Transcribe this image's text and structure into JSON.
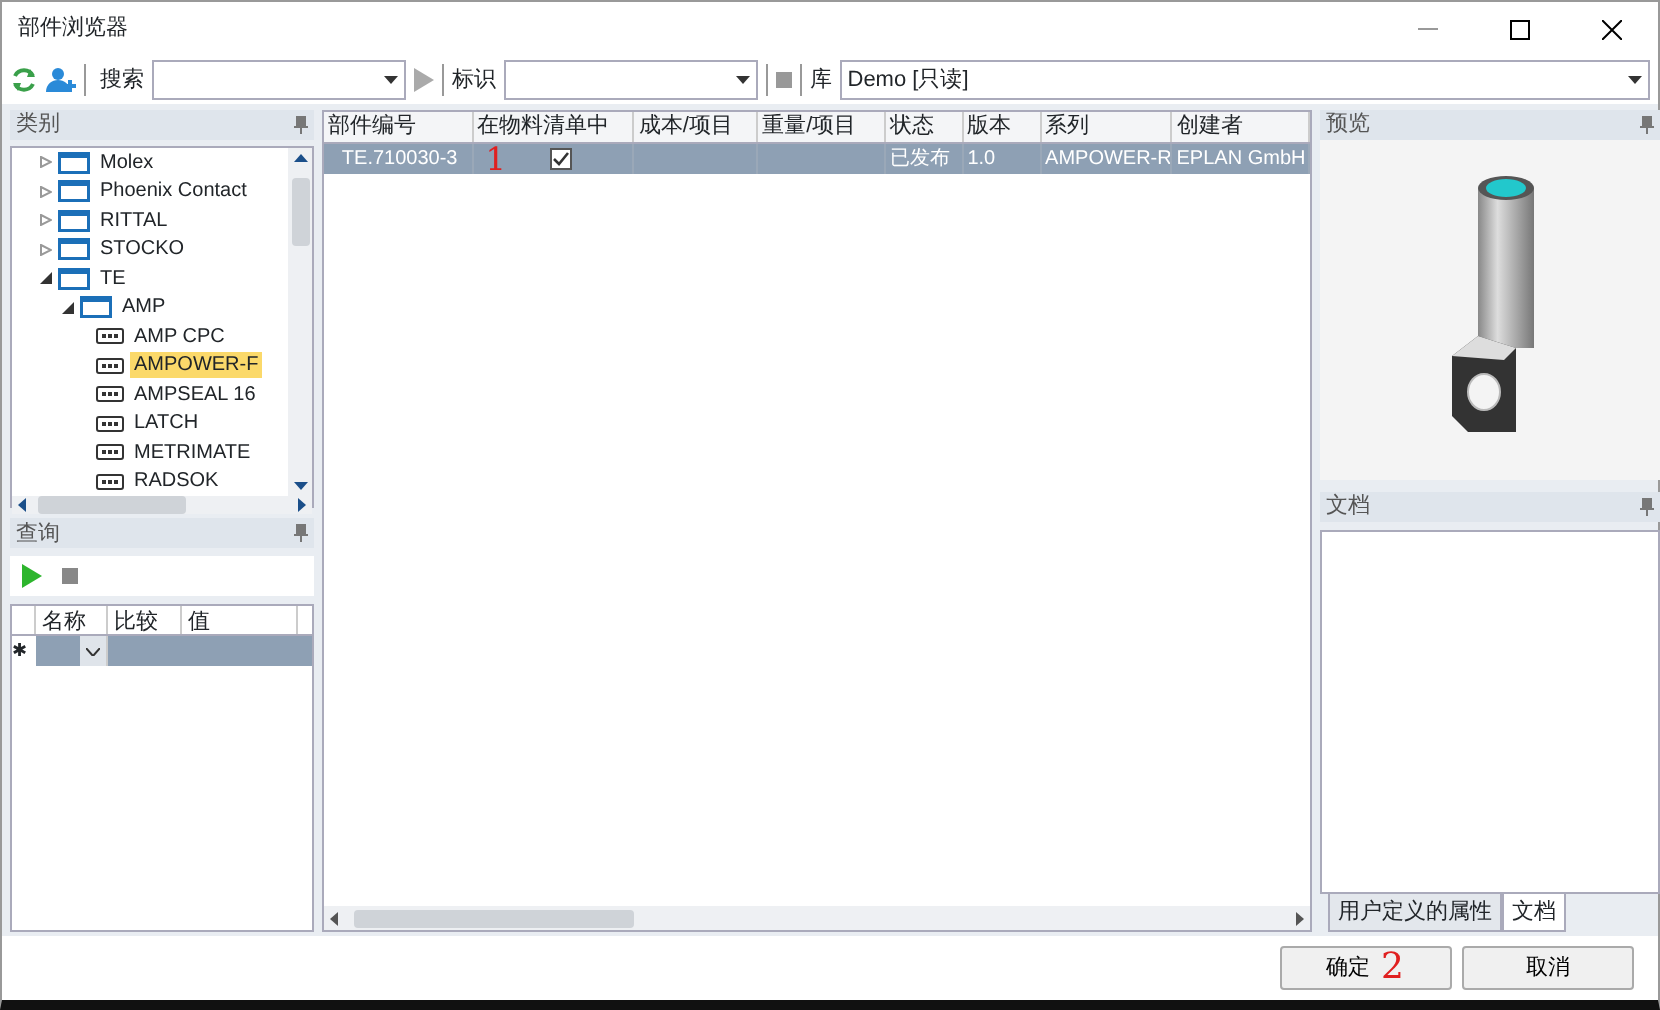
{
  "window": {
    "title": "部件浏览器"
  },
  "toolbar": {
    "search_label": "搜索",
    "play_disabled": true,
    "id_label": "标识",
    "library_label": "库",
    "library_value": "Demo [只读]"
  },
  "category_pane": {
    "title": "类别",
    "tree": [
      {
        "label": "Molex",
        "kind": "folder",
        "expanded": false,
        "selected": false
      },
      {
        "label": "Phoenix Contact",
        "kind": "folder",
        "expanded": false,
        "selected": false
      },
      {
        "label": "RITTAL",
        "kind": "folder",
        "expanded": false,
        "selected": false
      },
      {
        "label": "STOCKO",
        "kind": "folder",
        "expanded": false,
        "selected": false
      },
      {
        "label": "TE",
        "kind": "folder",
        "expanded": true,
        "selected": false,
        "children": [
          {
            "label": "AMP",
            "kind": "folder",
            "expanded": true,
            "selected": false,
            "children": [
              {
                "label": "AMP CPC",
                "kind": "part",
                "selected": false
              },
              {
                "label": "AMPOWER-F",
                "kind": "part",
                "selected": true
              },
              {
                "label": "AMPSEAL 16",
                "kind": "part",
                "selected": false
              },
              {
                "label": "LATCH",
                "kind": "part",
                "selected": false
              },
              {
                "label": "METRIMATE",
                "kind": "part",
                "selected": false
              },
              {
                "label": "RADSOK",
                "kind": "part",
                "selected": false
              }
            ]
          }
        ]
      }
    ]
  },
  "query_pane": {
    "title": "查询",
    "columns": [
      "名称",
      "比较",
      "值"
    ],
    "new_row_marker": "✱"
  },
  "parts_table": {
    "columns": [
      "部件编号",
      "在物料清单中",
      "成本/项目",
      "重量/项目",
      "状态",
      "版本",
      "系列",
      "创建者"
    ],
    "rows": [
      {
        "part_number": "TE.710030-3",
        "in_bom": true,
        "status": "已发布",
        "version": "1.0",
        "series": "AMPOWER-R",
        "creator": "EPLAN GmbH",
        "selected": true
      }
    ]
  },
  "preview_pane": {
    "title": "预览"
  },
  "document_pane": {
    "title": "文档",
    "tabs": [
      {
        "label": "用户定义的属性",
        "selected": false
      },
      {
        "label": "文档",
        "selected": true
      }
    ]
  },
  "buttons": [
    {
      "label": "确定"
    },
    {
      "label": "取消"
    }
  ],
  "annotations": [
    "1",
    "2"
  ]
}
